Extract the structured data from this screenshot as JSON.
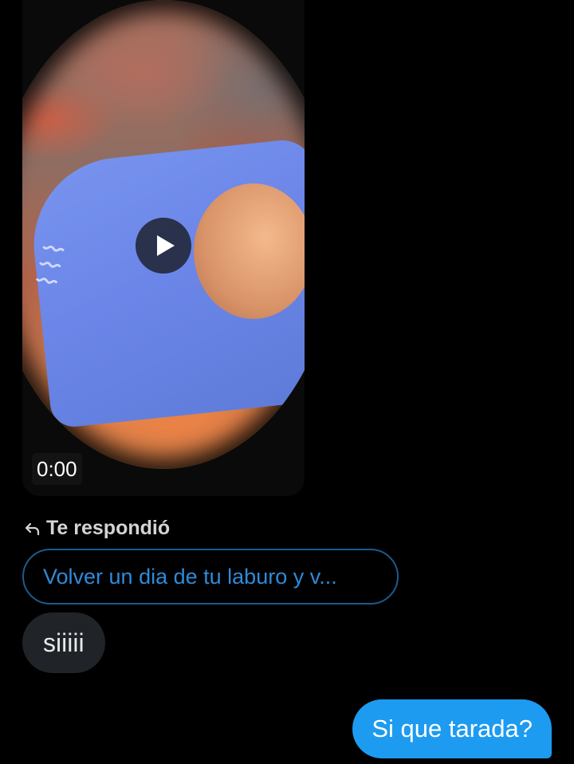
{
  "video_message": {
    "duration": "0:00",
    "play_icon": "play-icon"
  },
  "reply": {
    "icon": "reply-arrow-icon",
    "label": "Te respondió",
    "quoted_text": "Volver un dia de tu laburo y v..."
  },
  "messages": [
    {
      "direction": "incoming",
      "text": "siiiii"
    },
    {
      "direction": "outgoing",
      "text": "Si que tarada?"
    }
  ],
  "colors": {
    "background": "#000000",
    "outgoing_bubble": "#1d9bf0",
    "incoming_bubble": "#202327",
    "quote_border": "#1d5a8c",
    "quote_text": "#2f8ad8"
  }
}
